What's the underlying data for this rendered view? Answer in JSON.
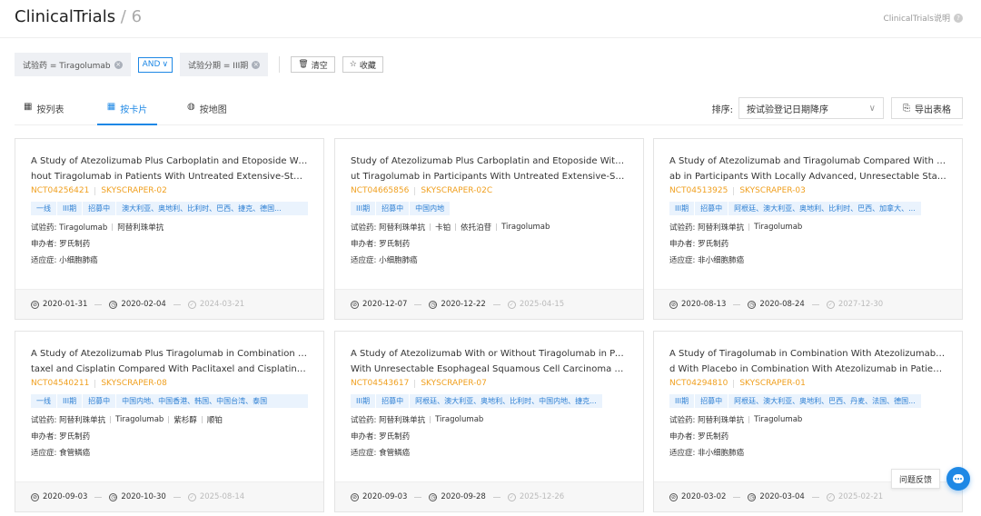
{
  "header": {
    "title": "ClinicalTrials",
    "count": " / 6",
    "help_label": "ClinicalTrials说明"
  },
  "filters": {
    "chip1": "试验药 = Tiragolumab",
    "logic": "AND",
    "chip2": "试验分期 = III期",
    "clear_label": "清空",
    "save_label": "收藏"
  },
  "tabs": [
    "按列表",
    "按卡片",
    "按地图"
  ],
  "sort": {
    "label": "排序:",
    "value": "按试验登记日期降序"
  },
  "export_label": "导出表格",
  "cards": [
    {
      "title1": "A Study of Atezolizumab Plus Carboplatin and Etoposide With or Wit",
      "title2": "hout Tiragolumab in Patients With Untreated Extensive-Stage Sma...",
      "nct": "NCT04256421",
      "alias": "SKYSCRAPER-02",
      "tags": [
        "一线",
        "III期",
        "招募中",
        "澳大利亚、奥地利、比利时、巴西、捷克、德国..."
      ],
      "drugs": [
        "试验药: Tiragolumab",
        "阿替利珠单抗"
      ],
      "sponsor": "申办者: 罗氏制药",
      "indication": "适应症: 小细胞肺癌",
      "dates": [
        "2020-01-31",
        "2020-02-04",
        "2024-03-21"
      ]
    },
    {
      "title1": "Study of Atezolizumab Plus Carboplatin and Etoposide With or Witho",
      "title2": "ut Tiragolumab in Participants With Untreated Extensive-Stage Sm...",
      "nct": "NCT04665856",
      "alias": "SKYSCRAPER-02C",
      "tags": [
        "III期",
        "招募中",
        "中国内地"
      ],
      "drugs": [
        "试验药: 阿替利珠单抗",
        "卡铂",
        "依托泊苷",
        "Tiragolumab"
      ],
      "sponsor": "申办者: 罗氏制药",
      "indication": "适应症: 小细胞肺癌",
      "dates": [
        "2020-12-07",
        "2020-12-22",
        "2025-04-15"
      ]
    },
    {
      "title1": "A Study of Atezolizumab and Tiragolumab Compared With Durvalum",
      "title2": "ab in Participants With Locally Advanced, Unresectable Stage III N...",
      "nct": "NCT04513925",
      "alias": "SKYSCRAPER-03",
      "tags": [
        "III期",
        "招募中",
        "阿根廷、澳大利亚、奥地利、比利时、巴西、加拿大、..."
      ],
      "drugs": [
        "试验药: 阿替利珠单抗",
        "Tiragolumab"
      ],
      "sponsor": "申办者: 罗氏制药",
      "indication": "适应症: 非小细胞肺癌",
      "dates": [
        "2020-08-13",
        "2020-08-24",
        "2027-12-30"
      ]
    },
    {
      "title1": "A Study of Atezolizumab Plus Tiragolumab in Combination With Pacli",
      "title2": "taxel and Cisplatin Compared With Paclitaxel and Cisplatin as First...",
      "nct": "NCT04540211",
      "alias": "SKYSCRAPER-08",
      "tags": [
        "一线",
        "III期",
        "招募中",
        "中国内地、中国香港、韩国、中国台湾、泰国"
      ],
      "drugs": [
        "试验药: 阿替利珠单抗",
        "Tiragolumab",
        "紫杉醇",
        "顺铂"
      ],
      "sponsor": "申办者: 罗氏制药",
      "indication": "适应症: 食管鳞癌",
      "dates": [
        "2020-09-03",
        "2020-10-30",
        "2025-08-14"
      ]
    },
    {
      "title1": "A Study of Atezolizumab With or Without Tiragolumab in Participants",
      "title2": "With Unresectable Esophageal Squamous Cell Carcinoma Whose ...",
      "nct": "NCT04543617",
      "alias": "SKYSCRAPER-07",
      "tags": [
        "III期",
        "招募中",
        "阿根廷、澳大利亚、奥地利、比利时、中国内地、捷克..."
      ],
      "drugs": [
        "试验药: 阿替利珠单抗",
        "Tiragolumab"
      ],
      "sponsor": "申办者: 罗氏制药",
      "indication": "适应症: 食管鳞癌",
      "dates": [
        "2020-09-03",
        "2020-09-28",
        "2025-12-26"
      ]
    },
    {
      "title1": "A Study of Tiragolumab in Combination With Atezolizumab Compare",
      "title2": "d With Placebo in Combination With Atezolizumab in Patients With...",
      "nct": "NCT04294810",
      "alias": "SKYSCRAPER-01",
      "tags": [
        "III期",
        "招募中",
        "阿根廷、澳大利亚、奥地利、巴西、丹麦、法国、德国..."
      ],
      "drugs": [
        "试验药: 阿替利珠单抗",
        "Tiragolumab"
      ],
      "sponsor": "申办者: 罗氏制药",
      "indication": "适应症: 非小细胞肺癌",
      "dates": [
        "2020-03-02",
        "2020-03-04",
        "2025-02-21"
      ]
    }
  ],
  "feedback_label": "问题反馈",
  "colors": {
    "accent": "#1e88e5",
    "nct": "#f0a020",
    "tag_bg": "#eaf3fd"
  }
}
